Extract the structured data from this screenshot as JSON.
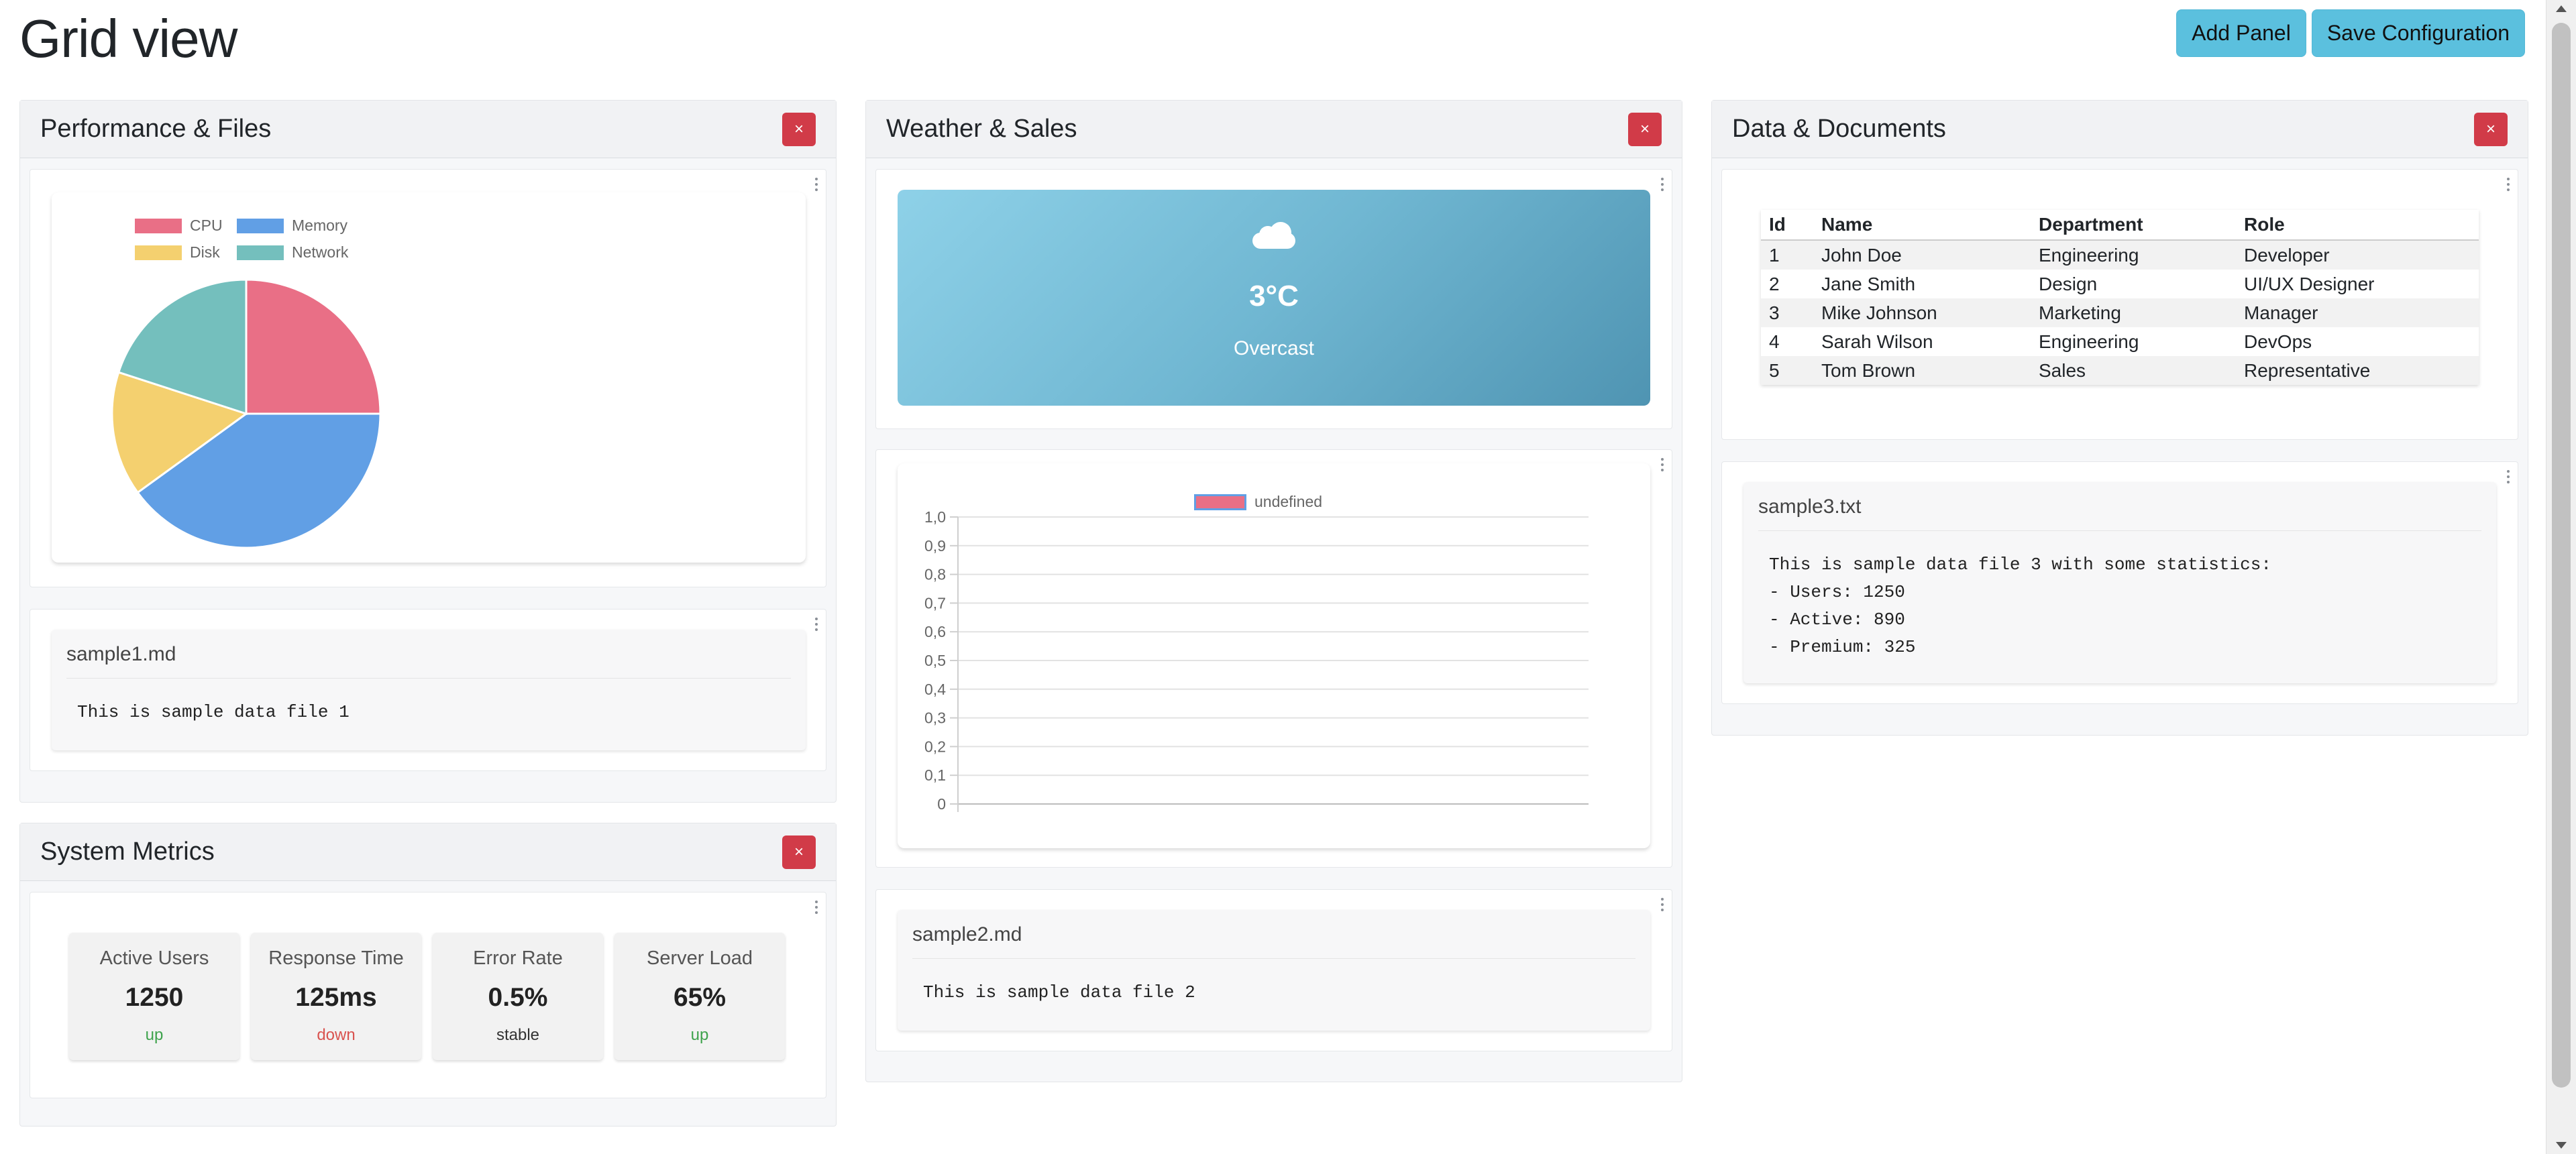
{
  "page": {
    "title": "Grid view"
  },
  "toolbar": {
    "add_panel_label": "Add Panel",
    "save_config_label": "Save Configuration"
  },
  "panels": {
    "performance": {
      "title": "Performance & Files",
      "close_label": "×"
    },
    "weather_sales": {
      "title": "Weather & Sales",
      "close_label": "×"
    },
    "data_docs": {
      "title": "Data & Documents",
      "close_label": "×"
    },
    "system_metrics": {
      "title": "System Metrics",
      "close_label": "×"
    }
  },
  "pie_chart": {
    "legend": [
      "CPU",
      "Memory",
      "Disk",
      "Network"
    ],
    "colors": [
      "#e96f86",
      "#619fe5",
      "#f4d06f",
      "#74bfbd"
    ]
  },
  "chart_data": [
    {
      "type": "pie",
      "categories": [
        "CPU",
        "Memory",
        "Disk",
        "Network"
      ],
      "values": [
        25,
        40,
        15,
        20
      ],
      "colors": [
        "#e96f86",
        "#619fe5",
        "#f4d06f",
        "#74bfbd"
      ],
      "legend": "top"
    },
    {
      "type": "bar",
      "categories": [],
      "series": [
        {
          "name": "undefined",
          "values": []
        }
      ],
      "ylim": [
        0,
        1
      ],
      "yticks": [
        "1,0",
        "0,9",
        "0,8",
        "0,7",
        "0,6",
        "0,5",
        "0,4",
        "0,3",
        "0,2",
        "0,1",
        "0"
      ],
      "grid": true,
      "legend": "top"
    }
  ],
  "files": {
    "sample1": {
      "name": "sample1.md",
      "content": "This is sample data file 1"
    },
    "sample2": {
      "name": "sample2.md",
      "content": "This is sample data file 2"
    },
    "sample3": {
      "name": "sample3.txt",
      "lines": [
        "This is sample data file 3 with some statistics:",
        "- Users: 1250",
        "- Active: 890",
        "- Premium: 325"
      ]
    }
  },
  "weather": {
    "icon": "cloud-icon",
    "temperature": "3°C",
    "condition": "Overcast"
  },
  "sales_chart": {
    "legend_label": "undefined",
    "legend_color": "#e96f86"
  },
  "table": {
    "headers": [
      "Id",
      "Name",
      "Department",
      "Role"
    ],
    "rows": [
      [
        "1",
        "John Doe",
        "Engineering",
        "Developer"
      ],
      [
        "2",
        "Jane Smith",
        "Design",
        "UI/UX Designer"
      ],
      [
        "3",
        "Mike Johnson",
        "Marketing",
        "Manager"
      ],
      [
        "4",
        "Sarah Wilson",
        "Engineering",
        "DevOps"
      ],
      [
        "5",
        "Tom Brown",
        "Sales",
        "Representative"
      ]
    ]
  },
  "metrics": [
    {
      "label": "Active Users",
      "value": "1250",
      "trend": "up",
      "trend_color": "#3fa34d"
    },
    {
      "label": "Response Time",
      "value": "125ms",
      "trend": "down",
      "trend_color": "#d9534f"
    },
    {
      "label": "Error Rate",
      "value": "0.5%",
      "trend": "stable",
      "trend_color": "#333333"
    },
    {
      "label": "Server Load",
      "value": "65%",
      "trend": "up",
      "trend_color": "#3fa34d"
    }
  ]
}
